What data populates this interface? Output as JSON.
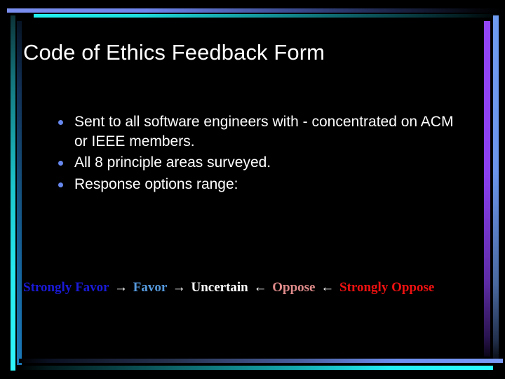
{
  "slide": {
    "title": "Code of Ethics Feedback Form",
    "bullets": [
      "Sent to all software engineers with - concentrated on ACM or IEEE members.",
      "All 8 principle areas surveyed.",
      "Response options range:"
    ],
    "scale": {
      "items": [
        {
          "label": "Strongly Favor",
          "color": "#1a1ad8"
        },
        {
          "label": "Favor",
          "color": "#5599dd"
        },
        {
          "label": "Uncertain",
          "color": "#ffffff"
        },
        {
          "label": "Oppose",
          "color": "#e08b8b"
        },
        {
          "label": "Strongly Oppose",
          "color": "#ee1111"
        }
      ],
      "arrow_right": "→",
      "arrow_left": "←"
    },
    "frame_colors": {
      "top_blue": "#6f86ee",
      "top_cyan": "#1fdede",
      "left_cyan": "#2ff6fb",
      "left_blue": "#1a78b8",
      "right_purple": "#8b40f0",
      "right_blue": "#6b95ec",
      "bottom_blue": "#7b9bf6",
      "bottom_cyan": "#2bfbff",
      "background": "#000000"
    },
    "bullet_marker_color": "#6688ee"
  }
}
